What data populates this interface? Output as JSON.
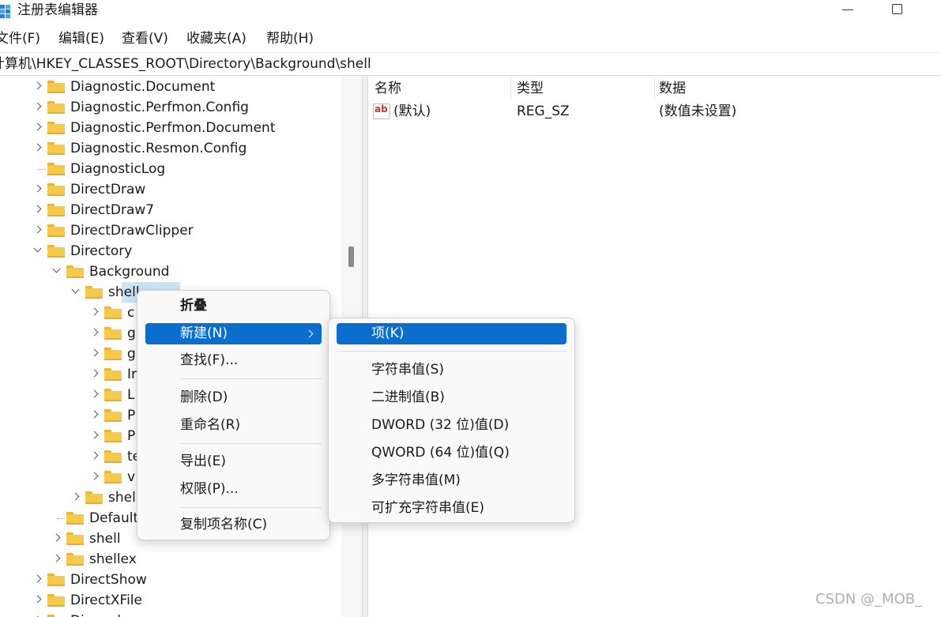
{
  "window": {
    "title": "注册表编辑器"
  },
  "menubar": {
    "file": "文件(F)",
    "edit": "编辑(E)",
    "view": "查看(V)",
    "favorites": "收藏夹(A)",
    "help": "帮助(H)"
  },
  "address": {
    "path": "计算机\\HKEY_CLASSES_ROOT\\Directory\\Background\\shell"
  },
  "tree": {
    "items": [
      {
        "label": "Diagnostic.Document",
        "expander": "collapsed"
      },
      {
        "label": "Diagnostic.Perfmon.Config",
        "expander": "collapsed"
      },
      {
        "label": "Diagnostic.Perfmon.Document",
        "expander": "collapsed"
      },
      {
        "label": "Diagnostic.Resmon.Config",
        "expander": "collapsed"
      },
      {
        "label": "DiagnosticLog",
        "expander": "none"
      },
      {
        "label": "DirectDraw",
        "expander": "collapsed"
      },
      {
        "label": "DirectDraw7",
        "expander": "collapsed"
      },
      {
        "label": "DirectDrawClipper",
        "expander": "collapsed"
      },
      {
        "label": "Directory",
        "expander": "expanded"
      },
      {
        "label": "Background",
        "expander": "expanded"
      },
      {
        "label": "shell",
        "expander": "expanded",
        "selected": true
      },
      {
        "label": "c",
        "expander": "collapsed"
      },
      {
        "label": "g",
        "expander": "collapsed"
      },
      {
        "label": "g",
        "expander": "collapsed"
      },
      {
        "label": "In",
        "expander": "collapsed"
      },
      {
        "label": "L",
        "expander": "collapsed"
      },
      {
        "label": "P",
        "expander": "collapsed"
      },
      {
        "label": "P",
        "expander": "collapsed"
      },
      {
        "label": "te",
        "expander": "collapsed"
      },
      {
        "label": "v",
        "expander": "collapsed"
      },
      {
        "label": "shel",
        "expander": "collapsed"
      },
      {
        "label": "Default",
        "expander": "none"
      },
      {
        "label": "shell",
        "expander": "collapsed"
      },
      {
        "label": "shellex",
        "expander": "collapsed"
      },
      {
        "label": "DirectShow",
        "expander": "collapsed"
      },
      {
        "label": "DirectXFile",
        "expander": "collapsed"
      },
      {
        "label": "Discord",
        "expander": "collapsed"
      }
    ]
  },
  "list": {
    "headers": {
      "name": "名称",
      "type": "类型",
      "data": "数据"
    },
    "rows": [
      {
        "icon": "reg-sz-icon",
        "name": "(默认)",
        "type": "REG_SZ",
        "data": "(数值未设置)"
      }
    ]
  },
  "context_menu": {
    "items": {
      "collapse": "折叠",
      "new": "新建(N)",
      "find": "查找(F)...",
      "delete": "删除(D)",
      "rename": "重命名(R)",
      "export": "导出(E)",
      "permissions": "权限(P)...",
      "copy_key_name": "复制项名称(C)"
    }
  },
  "new_submenu": {
    "items": {
      "key": "项(K)",
      "string_value": "字符串值(S)",
      "binary_value": "二进制值(B)",
      "dword_value": "DWORD (32 位)值(D)",
      "qword_value": "QWORD (64 位)值(Q)",
      "multi_string_value": "多字符串值(M)",
      "expandable_string_value": "可扩充字符串值(E)"
    }
  },
  "watermark": "CSDN @_MOB_",
  "colors": {
    "highlight": "#0a6ecf",
    "selection": "#cce4f7",
    "folder": "#f7c948"
  }
}
